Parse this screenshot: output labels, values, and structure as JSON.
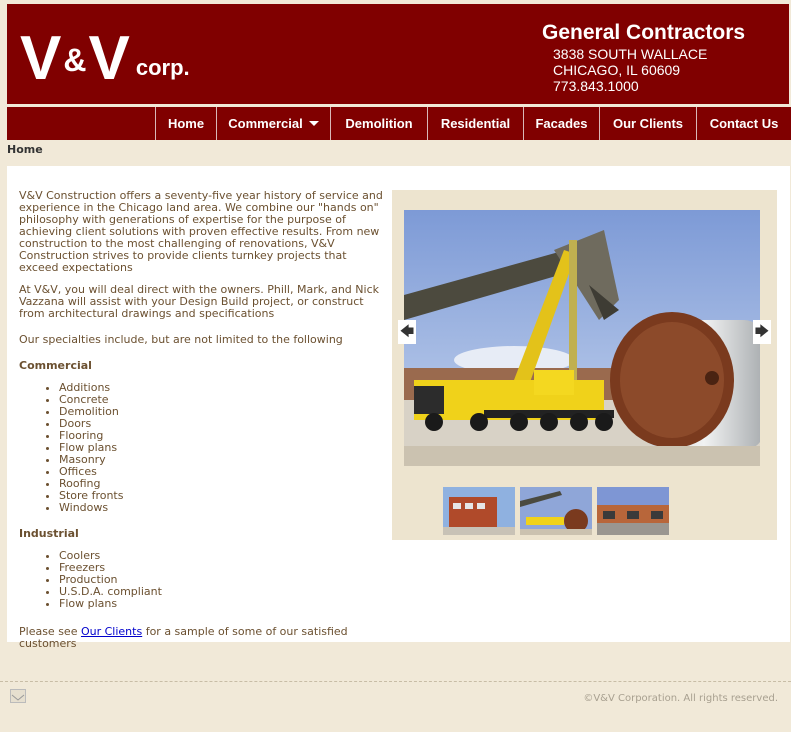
{
  "header": {
    "logo_v1": "V",
    "logo_amp": "&",
    "logo_v2": "V",
    "logo_corp": "corp.",
    "title": "General Contractors",
    "address1": "3838 SOUTH WALLACE",
    "address2": "CHICAGO, IL 60609",
    "phone": "773.843.1000",
    "brand_color": "#800000"
  },
  "nav": {
    "home": "Home",
    "commercial": "Commercial",
    "demolition": "Demolition",
    "residential": "Residential",
    "facades": "Facades",
    "clients": "Our Clients",
    "contact": "Contact Us"
  },
  "breadcrumb": "Home",
  "content": {
    "intro": "V&V Construction offers a seventy-five year history of service and experience in the Chicago land area. We combine our \"hands on\" philosophy with generations of expertise for the purpose of achieving client solutions with proven effective results. From new construction to the most challenging of renovations, V&V Construction strives to provide clients turnkey projects that exceed expectations",
    "owners": "At V&V, you will deal direct with the owners. Phill, Mark, and Nick Vazzana will assist with your Design Build project, or construct from architectural drawings and specifications",
    "specialties": "Our specialties include, but are not limited to the following",
    "commercial_heading": "Commercial",
    "commercial_items": [
      "Additions",
      "Concrete",
      "Demolition",
      "Doors",
      "Flooring",
      "Flow plans",
      "Masonry",
      "Offices",
      "Roofing",
      "Store fronts",
      "Windows"
    ],
    "industrial_heading": "Industrial",
    "industrial_items": [
      "Coolers",
      "Freezers",
      "Production",
      "U.S.D.A. compliant",
      "Flow plans"
    ],
    "closing_before": "Please see ",
    "closing_link": "Our Clients",
    "closing_after": " for a sample of some of our satisfied customers"
  },
  "slider": {
    "prev_icon": "arrow-left-icon",
    "next_icon": "arrow-right-icon",
    "prev_glyph": "🡄",
    "next_glyph": "🡆"
  },
  "footer": {
    "copyright": "©V&V Corporation. All rights reserved.",
    "mail_icon": "mail-icon"
  }
}
